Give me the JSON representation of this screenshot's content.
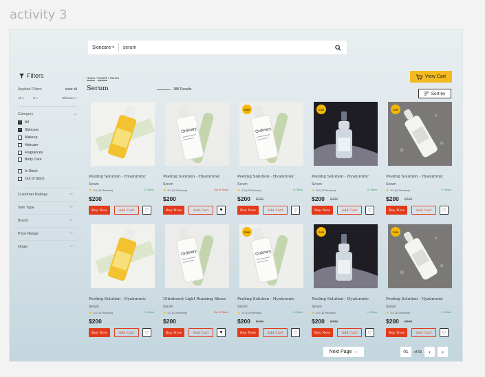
{
  "canvas_label": "activity 3",
  "search": {
    "category": "Skincare",
    "query": "serum"
  },
  "sidebar": {
    "title": "Filters",
    "applied_label": "Applied Filters",
    "clear_all": "clear all",
    "chips": [
      "All ×",
      "S ×",
      "Skincare ×"
    ],
    "category_label": "Category",
    "categories": [
      {
        "label": "All",
        "checked": true
      },
      {
        "label": "Skincare",
        "checked": true
      },
      {
        "label": "Makeup",
        "checked": false
      },
      {
        "label": "Haircare",
        "checked": false
      },
      {
        "label": "Fragrances",
        "checked": false
      },
      {
        "label": "Body Care",
        "checked": false
      }
    ],
    "stock": [
      {
        "label": "In Stock",
        "checked": false
      },
      {
        "label": "Out of Stock",
        "checked": false
      }
    ],
    "facets": [
      "Customer Ratings",
      "Skin Type",
      "Brand",
      "Price Range",
      "Origin"
    ]
  },
  "breadcrumb": {
    "home": "Home",
    "search": "Search",
    "current": "Serum"
  },
  "page_title": "Serum",
  "results": "388 Results",
  "view_cart": "View Cart",
  "sort_by": "Sort by",
  "sale_label": "Sale",
  "buy_now": "Buy Now",
  "add_cart": "Add Cart",
  "products": [
    {
      "name": "Peeling Solution - Hyaluronic",
      "category": "Serum",
      "rating": "5.0 (13 Reviews)",
      "stock": "In Stock",
      "in_stock": true,
      "price": "$200",
      "old_price": "",
      "sale": false,
      "wish": false,
      "img": "yellow"
    },
    {
      "name": "Peeling Solution - Hyaluronic",
      "category": "Serum",
      "rating": "5.0 (13 Reviews)",
      "stock": "Out of Stock",
      "in_stock": false,
      "price": "$200",
      "old_price": "",
      "sale": false,
      "wish": true,
      "img": "white"
    },
    {
      "name": "Peeling Solution - Hyaluronic",
      "category": "Serum",
      "rating": "5.0 (13 Reviews)",
      "stock": "In Stock",
      "in_stock": true,
      "price": "$200",
      "old_price": "$400",
      "sale": true,
      "wish": false,
      "img": "white2"
    },
    {
      "name": "Peeling Solution - Hyaluronic",
      "category": "Serum",
      "rating": "5.0 (13 Reviews)",
      "stock": "In Stock",
      "in_stock": true,
      "price": "$200",
      "old_price": "$400",
      "sale": true,
      "wish": false,
      "img": "dark"
    },
    {
      "name": "Peeling Solution - Hyaluronic",
      "category": "Serum",
      "rating": "5.0 (13 Reviews)",
      "stock": "In Stock",
      "in_stock": true,
      "price": "$200",
      "old_price": "$400",
      "sale": true,
      "wish": false,
      "img": "grey"
    },
    {
      "name": "Peeling Solution - Hyaluronic",
      "category": "Serum",
      "rating": "5.0 (13 Reviews)",
      "stock": "In Stock",
      "in_stock": true,
      "price": "$200",
      "old_price": "",
      "sale": false,
      "wish": false,
      "img": "yellow"
    },
    {
      "name": "Ultraboost Light Running Shoes",
      "category": "Serum",
      "rating": "5.0 (13 Reviews)",
      "stock": "Out of Stock",
      "in_stock": false,
      "price": "$200",
      "old_price": "",
      "sale": false,
      "wish": true,
      "img": "white"
    },
    {
      "name": "Peeling Solution - Hyaluronic",
      "category": "Serum",
      "rating": "5.0 (13 Reviews)",
      "stock": "In Stock",
      "in_stock": true,
      "price": "$200",
      "old_price": "$400",
      "sale": true,
      "wish": false,
      "img": "white2"
    },
    {
      "name": "Peeling Solution - Hyaluronic",
      "category": "Serum",
      "rating": "5.0 (13 Reviews)",
      "stock": "In Stock",
      "in_stock": true,
      "price": "$200",
      "old_price": "$400",
      "sale": true,
      "wish": false,
      "img": "dark"
    },
    {
      "name": "Peeling Solution - Hyaluronic",
      "category": "Serum",
      "rating": "5.0 (13 Reviews)",
      "stock": "In Stock",
      "in_stock": true,
      "price": "$200",
      "old_price": "$400",
      "sale": true,
      "wish": false,
      "img": "grey"
    }
  ],
  "pagination": {
    "next": "Next Page →",
    "current": "01",
    "total": "of 55"
  }
}
